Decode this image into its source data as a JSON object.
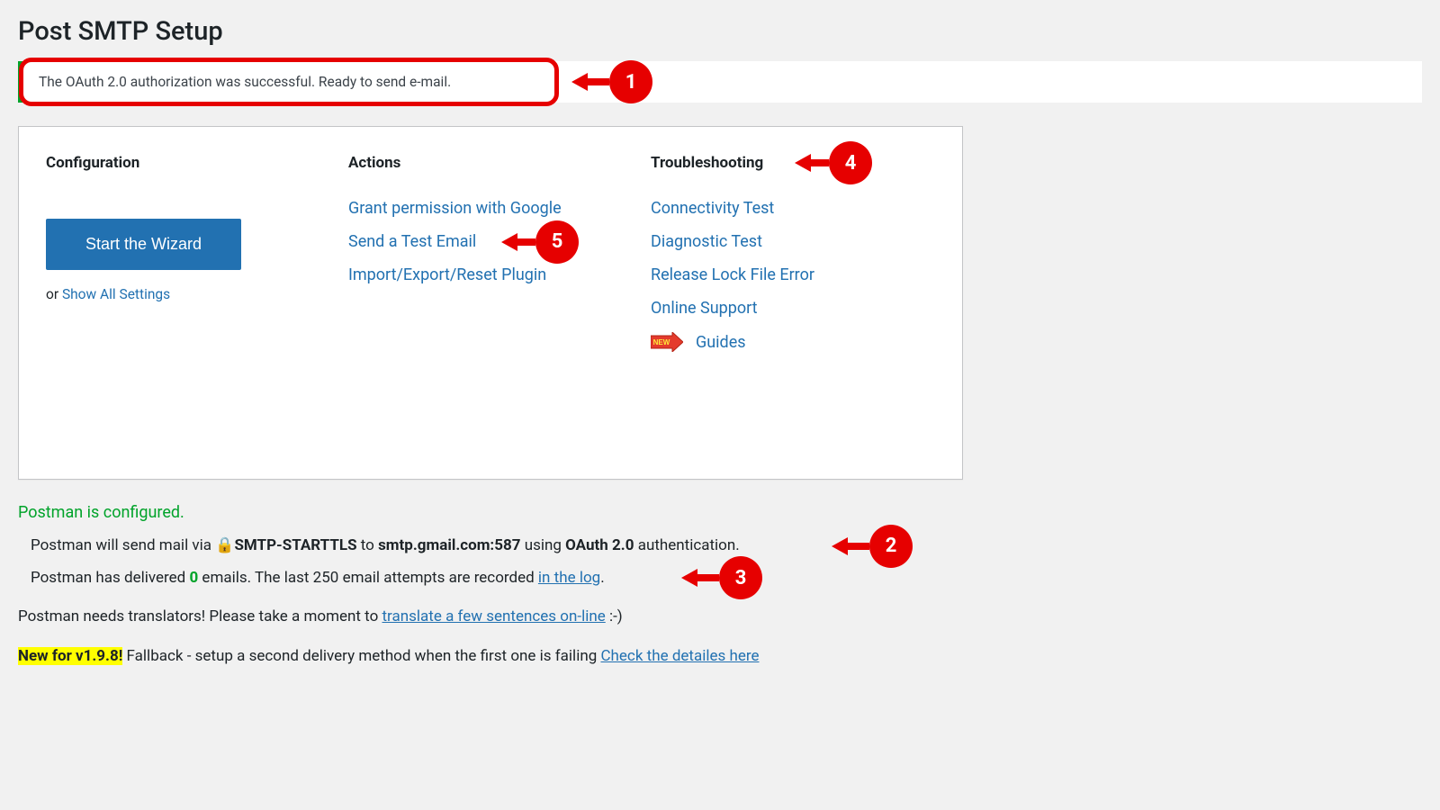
{
  "page": {
    "title": "Post SMTP Setup"
  },
  "notice": {
    "text": "The OAuth 2.0 authorization was successful. Ready to send e-mail."
  },
  "columns": {
    "configuration": {
      "title": "Configuration",
      "wizard_button": "Start the Wizard",
      "or_text": "or ",
      "show_all": "Show All Settings"
    },
    "actions": {
      "title": "Actions",
      "items": [
        "Grant permission with Google",
        "Send a Test Email",
        "Import/Export/Reset Plugin"
      ]
    },
    "troubleshooting": {
      "title": "Troubleshooting",
      "items": [
        "Connectivity Test",
        "Diagnostic Test",
        "Release Lock File Error",
        "Online Support"
      ],
      "guides": "Guides",
      "new_badge": "NEW"
    }
  },
  "status": {
    "configured": "Postman is configured.",
    "line1_pre": "Postman will send mail via ",
    "line1_protocol": "SMTP-STARTTLS",
    "line1_to": " to ",
    "line1_host": "smtp.gmail.com:587",
    "line1_using": " using ",
    "line1_auth": "OAuth 2.0",
    "line1_post": " authentication.",
    "line2_pre": "Postman has delivered ",
    "line2_count": "0",
    "line2_mid": " emails. The last 250 email attempts are recorded ",
    "line2_link": "in the log",
    "line2_post": "."
  },
  "footer": {
    "translate_pre": "Postman needs translators! Please take a moment to ",
    "translate_link": "translate a few sentences on-line",
    "translate_post": " :-)",
    "new_badge": "New for v1.9.8!",
    "fallback_text": " Fallback - setup a second delivery method when the first one is failing ",
    "fallback_link": "Check the detailes here"
  },
  "annotations": {
    "n1": "1",
    "n2": "2",
    "n3": "3",
    "n4": "4",
    "n5": "5"
  }
}
